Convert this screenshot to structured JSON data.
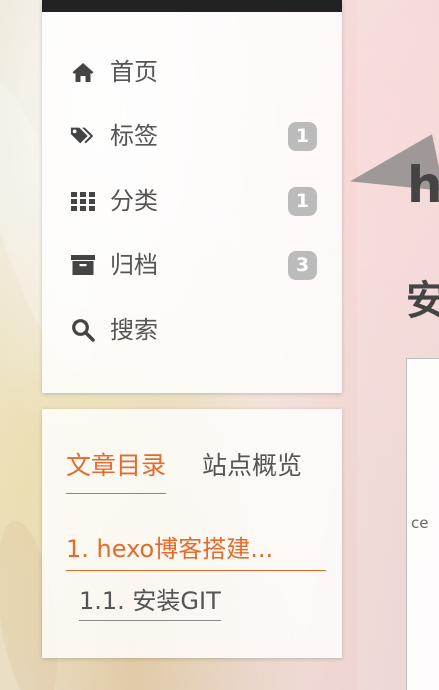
{
  "menu": {
    "items": [
      {
        "label": "首页",
        "icon": "home-icon",
        "badge": null
      },
      {
        "label": "标签",
        "icon": "tags-icon",
        "badge": "1"
      },
      {
        "label": "分类",
        "icon": "grid-icon",
        "badge": "1"
      },
      {
        "label": "归档",
        "icon": "archive-icon",
        "badge": "3"
      },
      {
        "label": "搜索",
        "icon": "search-icon",
        "badge": null
      }
    ]
  },
  "toc": {
    "tab_active": "文章目录",
    "tab_inactive": "站点概览",
    "items": [
      {
        "label": "1. hexo博客搭建..."
      },
      {
        "label": "1.1. 安装GIT"
      }
    ]
  },
  "main": {
    "title_partial": "h",
    "subtitle_partial": "安",
    "snippet_partial": "ce"
  },
  "colors": {
    "accent": "#e66a2c",
    "text": "#555555",
    "badge_bg": "#bbbbbb",
    "topbar": "#222222"
  }
}
